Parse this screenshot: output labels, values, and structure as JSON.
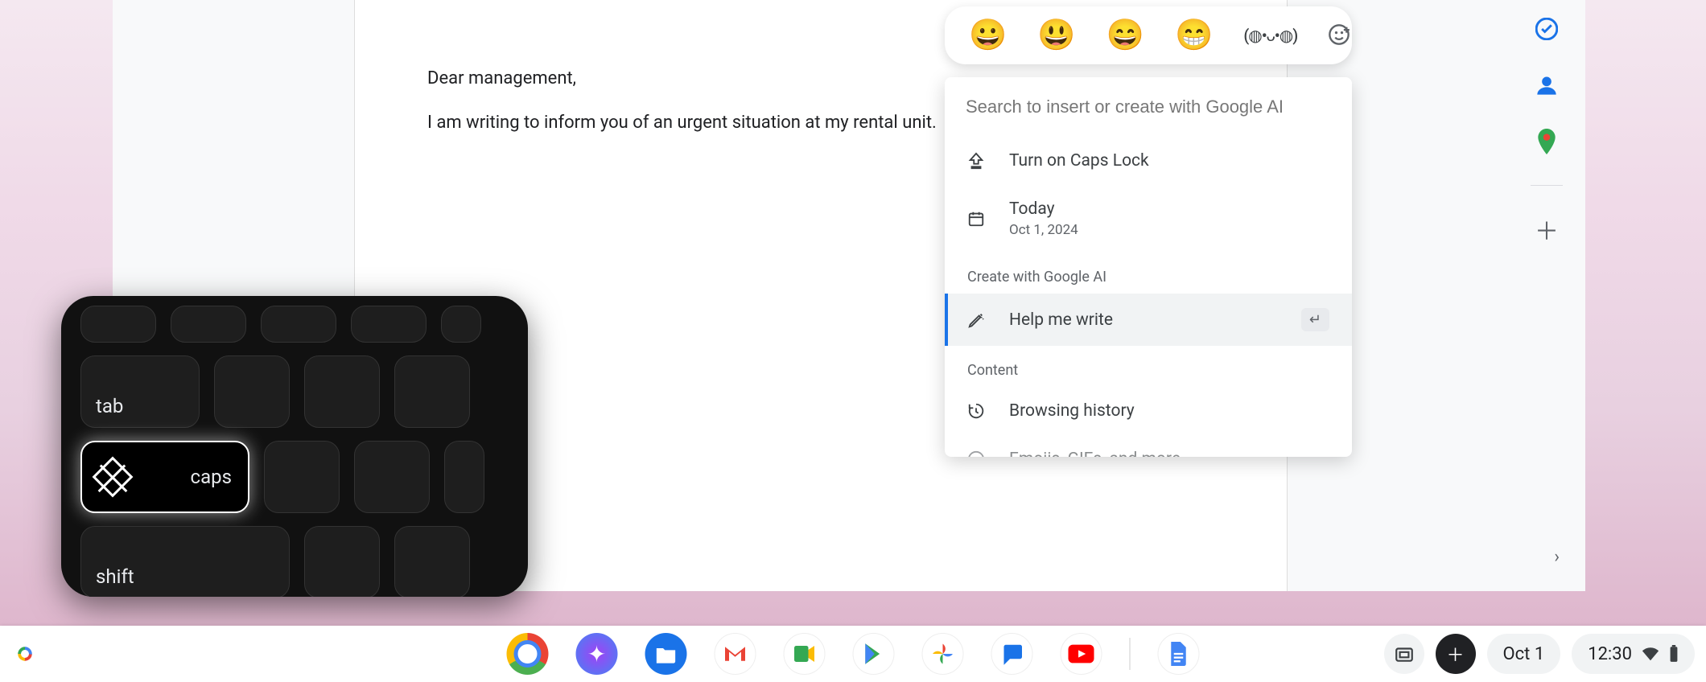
{
  "document": {
    "greeting": "Dear management,",
    "body_line1": "I am writing to inform you of an urgent situation at my rental unit."
  },
  "emoji_bar": {
    "items": [
      "😀",
      "😃",
      "😄",
      "😁"
    ],
    "kaomoji": "(◍•ᴗ•◍)"
  },
  "ai_panel": {
    "search_placeholder": "Search to insert or create with Google AI",
    "caps_lock_label": "Turn on Caps Lock",
    "today_label": "Today",
    "today_date": "Oct 1, 2024",
    "section_create": "Create with Google AI",
    "help_write_label": "Help me write",
    "enter_hint": "↵",
    "section_content": "Content",
    "browsing_history_label": "Browsing history",
    "emojis_label": "Emojis, GIFs, and more"
  },
  "keyboard": {
    "tab": "tab",
    "caps": "caps",
    "shift": "shift"
  },
  "shelf": {
    "date": "Oct 1",
    "time": "12:30"
  },
  "side_panel": {
    "tasks": "tasks-icon",
    "contacts": "contacts-icon",
    "maps": "maps-icon"
  }
}
